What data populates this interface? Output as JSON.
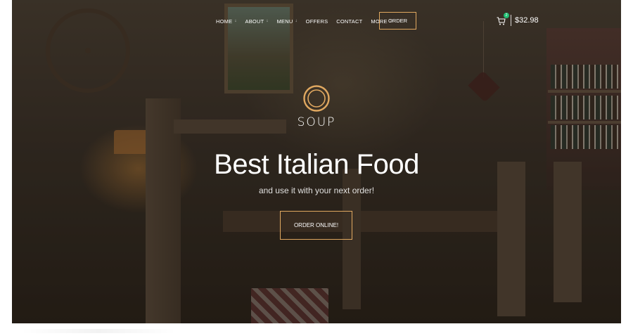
{
  "nav": {
    "items": [
      {
        "label": "HOME",
        "has_dropdown": true
      },
      {
        "label": "ABOUT",
        "has_dropdown": true
      },
      {
        "label": "MENU",
        "has_dropdown": true
      },
      {
        "label": "OFFERS",
        "has_dropdown": false
      },
      {
        "label": "CONTACT",
        "has_dropdown": false
      },
      {
        "label": "MORE",
        "has_dropdown": true
      }
    ],
    "order_label": "ORDER"
  },
  "cart": {
    "count": "2",
    "total": "$32.98",
    "badge_color": "#1fbf72"
  },
  "brand": {
    "name": "SOUP",
    "accent_color": "#e0a860"
  },
  "hero": {
    "headline": "Best Italian Food",
    "subline": "and use it with your next order!",
    "cta_label": "ORDER ONLINE!"
  }
}
